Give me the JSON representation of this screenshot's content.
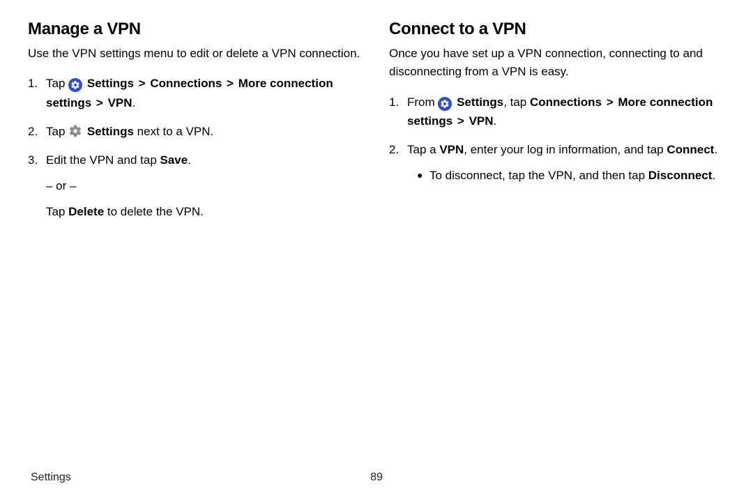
{
  "left": {
    "heading": "Manage a VPN",
    "intro": "Use the VPN settings menu to edit or delete a VPN connection.",
    "step1": {
      "num": "1.",
      "pre": "Tap ",
      "settings": "Settings",
      "sep1": ">",
      "connections": "Connections",
      "sep2": ">",
      "more": "More connection settings",
      "sep3": ">",
      "vpn": "VPN",
      "post": "."
    },
    "step2": {
      "num": "2.",
      "pre": "Tap ",
      "settings": "Settings",
      "post": " next to a VPN."
    },
    "step3": {
      "num": "3.",
      "pre": "Edit the VPN and tap ",
      "save": "Save",
      "post": ".",
      "or": "– or –",
      "alt_pre": "Tap ",
      "delete": "Delete",
      "alt_post": " to delete the VPN."
    }
  },
  "right": {
    "heading": "Connect to a VPN",
    "intro": "Once you have set up a VPN connection, connecting to and disconnecting from a VPN is easy.",
    "step1": {
      "num": "1.",
      "pre": "From ",
      "settings": "Settings",
      "mid": ", tap ",
      "connections": "Connections",
      "sep1": ">",
      "more": "More connection settings",
      "sep2": ">",
      "vpn": "VPN",
      "post": "."
    },
    "step2": {
      "num": "2.",
      "pre": "Tap a ",
      "vpn": "VPN",
      "mid": ", enter your log in information, and tap ",
      "connect": "Connect",
      "post": "."
    },
    "bullet": {
      "dot": "●",
      "pre": "To disconnect, tap the VPN, and then tap ",
      "disconnect": "Disconnect",
      "post": "."
    }
  },
  "footer": {
    "section": "Settings",
    "page": "89"
  }
}
